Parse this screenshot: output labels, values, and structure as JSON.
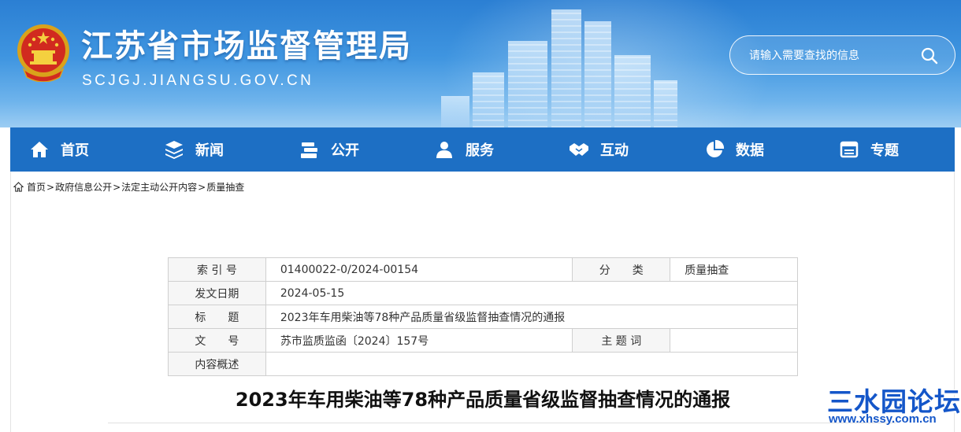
{
  "header": {
    "title": "江苏省市场监督管理局",
    "domain": "SCJGJ.JIANGSU.GOV.CN",
    "search_placeholder": "请输入需要查找的信息"
  },
  "nav": {
    "items": [
      {
        "label": "首页",
        "icon": "home-icon"
      },
      {
        "label": "新闻",
        "icon": "layers-icon"
      },
      {
        "label": "公开",
        "icon": "book-stack-icon"
      },
      {
        "label": "服务",
        "icon": "users-icon"
      },
      {
        "label": "互动",
        "icon": "handshake-icon"
      },
      {
        "label": "数据",
        "icon": "pie-chart-icon"
      },
      {
        "label": "专题",
        "icon": "window-icon"
      }
    ]
  },
  "breadcrumb": {
    "items": [
      "首页",
      "政府信息公开",
      "法定主动公开内容",
      "质量抽查"
    ],
    "separator": ">"
  },
  "info": {
    "index_label": "索 引 号",
    "index_value": "01400022-0/2024-00154",
    "category_label": "分　　类",
    "category_value": "质量抽查",
    "date_label": "发文日期",
    "date_value": "2024-05-15",
    "title_label": "标　　题",
    "title_value": "2023年车用柴油等78种产品质量省级监督抽查情况的通报",
    "docno_label": "文　　号",
    "docno_value": "苏市监质监函〔2024〕157号",
    "keyword_label": "主 题 词",
    "keyword_value": "",
    "summary_label": "内容概述",
    "summary_value": ""
  },
  "article": {
    "title": "2023年车用柴油等78种产品质量省级监督抽查情况的通报"
  },
  "watermark": {
    "text": "三水园论坛",
    "url": "www.xhssy.com.cn"
  },
  "colors": {
    "nav_bg": "#1d6fc4",
    "banner_top": "#2b7fd3",
    "watermark": "#1456c9"
  }
}
